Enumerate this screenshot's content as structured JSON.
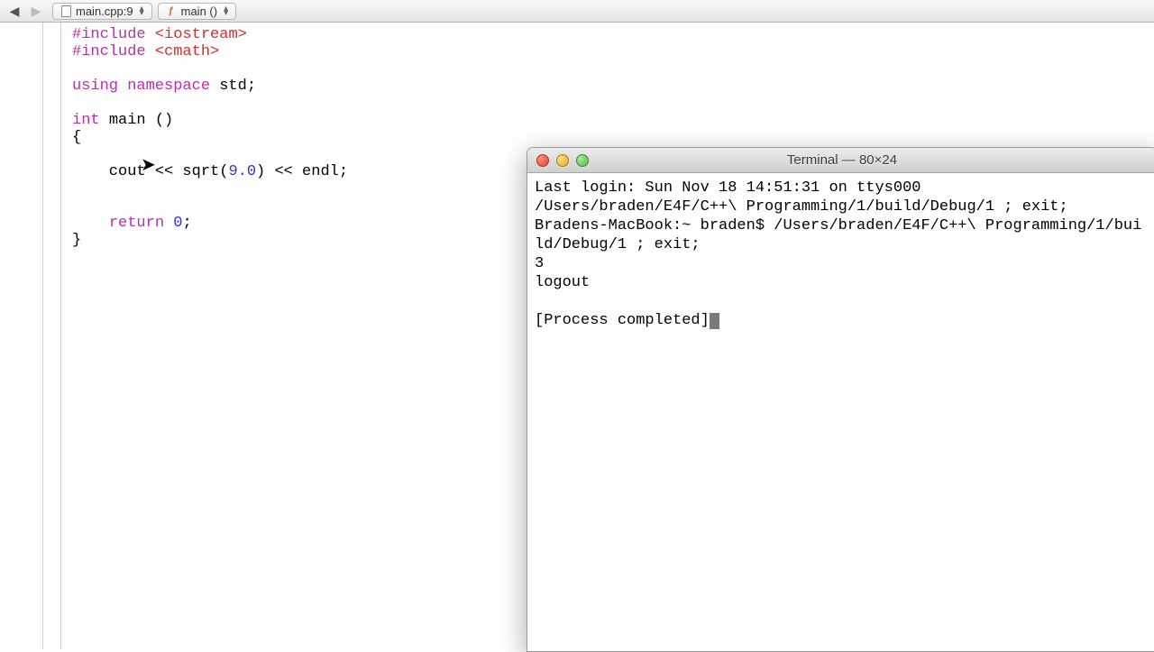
{
  "nav": {
    "file_crumb": "main.cpp:9",
    "func_crumb": "main ()"
  },
  "code": {
    "lines": [
      {
        "tokens": [
          {
            "t": "#include ",
            "c": "kw"
          },
          {
            "t": "<iostream>",
            "c": "str"
          }
        ]
      },
      {
        "tokens": [
          {
            "t": "#include ",
            "c": "kw"
          },
          {
            "t": "<cmath>",
            "c": "str"
          }
        ]
      },
      {
        "tokens": [
          {
            "t": "",
            "c": ""
          }
        ]
      },
      {
        "tokens": [
          {
            "t": "using namespace ",
            "c": "kw"
          },
          {
            "t": "std;",
            "c": "ident"
          }
        ]
      },
      {
        "tokens": [
          {
            "t": "",
            "c": ""
          }
        ]
      },
      {
        "tokens": [
          {
            "t": "int ",
            "c": "typ"
          },
          {
            "t": "main ()",
            "c": "ident"
          }
        ]
      },
      {
        "tokens": [
          {
            "t": "{",
            "c": "ident"
          }
        ]
      },
      {
        "tokens": [
          {
            "t": "",
            "c": ""
          }
        ]
      },
      {
        "tokens": [
          {
            "t": "    cout << sqrt(",
            "c": "ident"
          },
          {
            "t": "9.0",
            "c": "num"
          },
          {
            "t": ") << endl;",
            "c": "ident"
          }
        ]
      },
      {
        "tokens": [
          {
            "t": "",
            "c": ""
          }
        ]
      },
      {
        "tokens": [
          {
            "t": "",
            "c": ""
          }
        ]
      },
      {
        "tokens": [
          {
            "t": "    ",
            "c": ""
          },
          {
            "t": "return ",
            "c": "kw"
          },
          {
            "t": "0",
            "c": "num"
          },
          {
            "t": ";",
            "c": "ident"
          }
        ]
      },
      {
        "tokens": [
          {
            "t": "}",
            "c": "ident"
          }
        ]
      }
    ]
  },
  "terminal": {
    "title": "Terminal — 80×24",
    "lines": [
      "Last login: Sun Nov 18 14:51:31 on ttys000",
      "/Users/braden/E4F/C++\\ Programming/1/build/Debug/1 ; exit;",
      "Bradens-MacBook:~ braden$ /Users/braden/E4F/C++\\ Programming/1/build/Debug/1 ; exit;",
      "3",
      "logout",
      "",
      "[Process completed]"
    ]
  }
}
